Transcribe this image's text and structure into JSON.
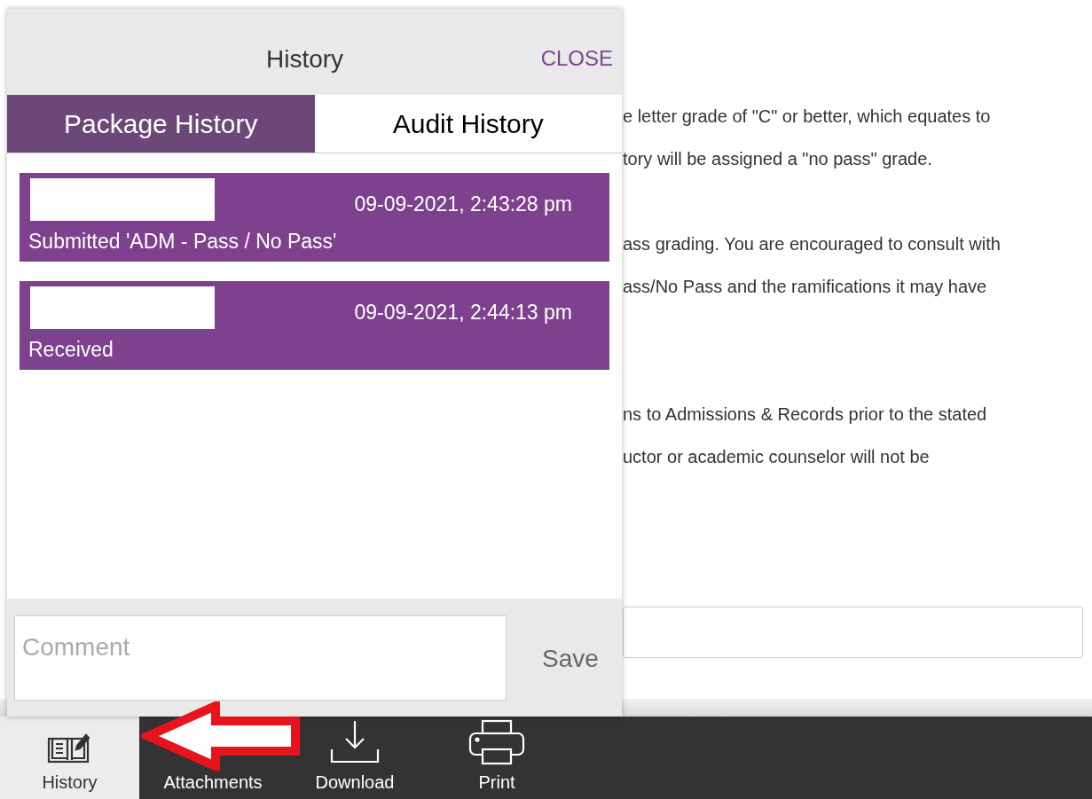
{
  "document": {
    "paragraphs": [
      [
        "e letter grade of \"C\" or better, which equates to",
        "tory will be assigned a \"no pass\" grade."
      ],
      [
        "ass grading. You are encouraged to consult with",
        "ass/No Pass and the ramifications it may have"
      ],
      [
        "ns to Admissions & Records prior to the stated",
        "uctor or academic counselor will not be"
      ]
    ]
  },
  "panel": {
    "title": "History",
    "close": "CLOSE",
    "tabs": [
      {
        "label": "Package History",
        "selected": true
      },
      {
        "label": "Audit History",
        "selected": false
      }
    ],
    "entries": [
      {
        "timestamp": "09-09-2021, 2:43:28 pm",
        "action": "Submitted 'ADM - Pass / No Pass'"
      },
      {
        "timestamp": "09-09-2021, 2:44:13 pm",
        "action": "Received"
      }
    ],
    "comment": {
      "placeholder": "Comment"
    },
    "save": "Save"
  },
  "toolbar": [
    {
      "label": "History",
      "kind": "history",
      "selected": true
    },
    {
      "label": "Attachments",
      "kind": "attachments",
      "selected": false
    },
    {
      "label": "Download",
      "kind": "download",
      "selected": false
    },
    {
      "label": "Print",
      "kind": "print",
      "selected": false
    }
  ]
}
